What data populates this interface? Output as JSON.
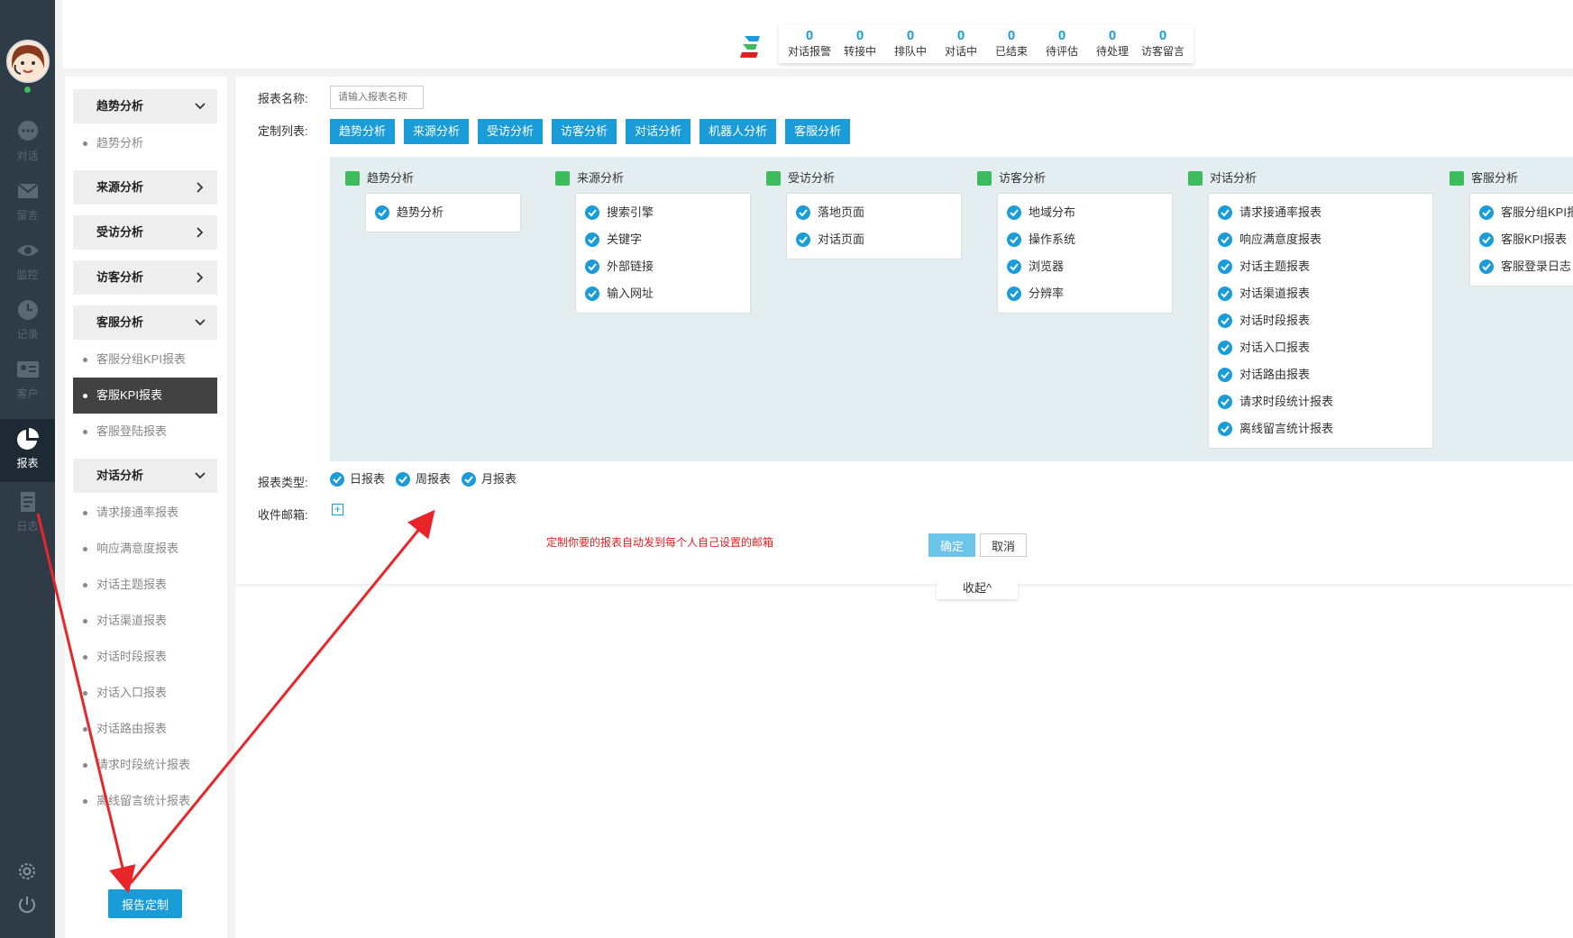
{
  "header": {
    "stats": [
      {
        "value": "0",
        "label": "对话报警"
      },
      {
        "value": "0",
        "label": "转接中"
      },
      {
        "value": "0",
        "label": "排队中"
      },
      {
        "value": "0",
        "label": "对话中"
      },
      {
        "value": "0",
        "label": "已结束"
      },
      {
        "value": "0",
        "label": "待评估"
      },
      {
        "value": "0",
        "label": "待处理"
      },
      {
        "value": "0",
        "label": "访客留言"
      }
    ]
  },
  "rail": {
    "items": [
      "对话",
      "留言",
      "监控",
      "记录",
      "客户",
      "报表",
      "日志"
    ],
    "active": "报表"
  },
  "subnav": {
    "groups": [
      {
        "label": "趋势分析",
        "items": [
          "趋势分析"
        ]
      },
      {
        "label": "来源分析"
      },
      {
        "label": "受访分析"
      },
      {
        "label": "访客分析"
      },
      {
        "label": "客服分析",
        "items": [
          "客服分组KPI报表",
          "客服KPI报表",
          "客服登陆报表"
        ]
      },
      {
        "label": "对话分析",
        "items": [
          "请求接通率报表",
          "响应满意度报表",
          "对话主题报表",
          "对话渠道报表",
          "对话时段报表",
          "对话入口报表",
          "对话路由报表",
          "请求时段统计报表",
          "离线留言统计报表"
        ]
      }
    ],
    "report_button": "报告定制"
  },
  "form": {
    "name_label": "报表名称:",
    "name_placeholder": "请输入报表名称",
    "list_label": "定制列表:",
    "tabs": [
      "趋势分析",
      "来源分析",
      "受访分析",
      "访客分析",
      "对话分析",
      "机器人分析",
      "客服分析"
    ],
    "columns": [
      {
        "title": "趋势分析",
        "options": [
          "趋势分析"
        ]
      },
      {
        "title": "来源分析",
        "options": [
          "搜索引擎",
          "关键字",
          "外部链接",
          "输入网址"
        ]
      },
      {
        "title": "受访分析",
        "options": [
          "落地页面",
          "对话页面"
        ]
      },
      {
        "title": "访客分析",
        "options": [
          "地域分布",
          "操作系统",
          "浏览器",
          "分辨率"
        ]
      },
      {
        "title": "对话分析",
        "options": [
          "请求接通率报表",
          "响应满意度报表",
          "对话主题报表",
          "对话渠道报表",
          "对话时段报表",
          "对话入口报表",
          "对话路由报表",
          "请求时段统计报表",
          "离线留言统计报表"
        ]
      },
      {
        "title": "客服分析",
        "options": [
          "客服分组KPI报",
          "客服KPI报表",
          "客服登录日志"
        ]
      }
    ],
    "type_label": "报表类型:",
    "types": [
      "日报表",
      "周报表",
      "月报表"
    ],
    "email_label": "收件邮箱:",
    "note": "定制你要的报表自动发到每个人自己设置的邮箱",
    "ok": "确定",
    "cancel": "取消",
    "collapse": "收起^"
  },
  "colors": {
    "accent": "#1a9cd8",
    "check": "#3dbb5d",
    "sidebar": "#2f3b47",
    "note": "#e02020"
  }
}
